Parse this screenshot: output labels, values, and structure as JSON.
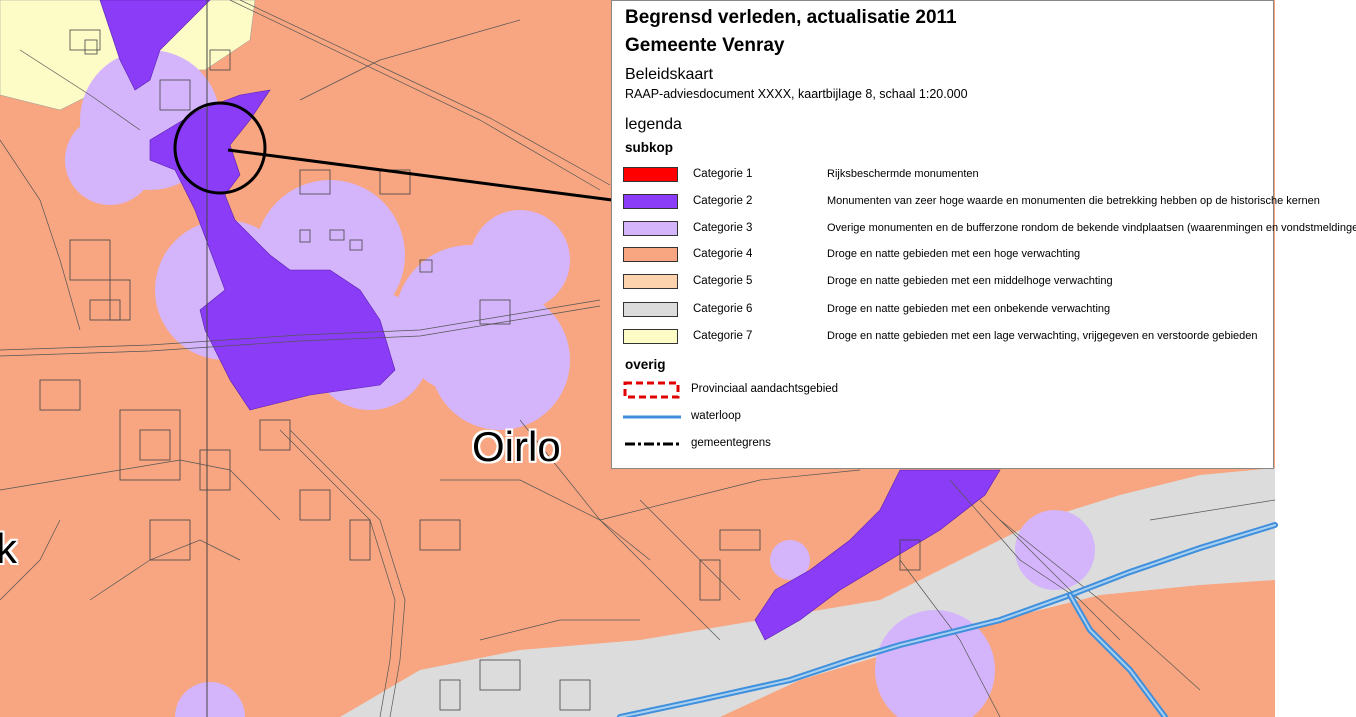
{
  "title_line1": "Begrensd verleden, actualisatie 2011",
  "title_line2": "Gemeente Venray",
  "map_type": "Beleidskaart",
  "document_note": "RAAP-adviesdocument XXXX, kaartbijlage 8, schaal 1:20.000",
  "legend_heading": "legenda",
  "subkop_label": "subkop",
  "categories": [
    {
      "label": "Categorie 1",
      "description": "Rijksbeschermde monumenten",
      "color": "#ff0000"
    },
    {
      "label": "Categorie 2",
      "description": "Monumenten van zeer hoge waarde en monumenten die betrekking hebben op de historische kernen",
      "color": "#8b3cf7"
    },
    {
      "label": "Categorie 3",
      "description": "Overige monumenten en de bufferzone rondom de bekende vindplaatsen (waarenmingen en vondstmeldingen)",
      "color": "#d4b5fb"
    },
    {
      "label": "Categorie 4",
      "description": "Droge en natte gebieden met een hoge verwachting",
      "color": "#f7a681"
    },
    {
      "label": "Categorie 5",
      "description": "Droge en natte gebieden met een middelhoge verwachting",
      "color": "#fdd3ae"
    },
    {
      "label": "Categorie 6",
      "description": "Droge en natte gebieden met een onbekende verwachting",
      "color": "#dcdcdc"
    },
    {
      "label": "Categorie 7",
      "description": "Droge en natte gebieden met een lage verwachting, vrijgegeven en verstoorde gebieden",
      "color": "#fdfbc6"
    }
  ],
  "overig_label": "overig",
  "other_symbols": [
    {
      "label": "Provinciaal aandachtsgebied",
      "symbol": "dashed-red-box",
      "color": "#e00000"
    },
    {
      "label": "waterloop",
      "symbol": "blue-line",
      "color": "#3f8fdc"
    },
    {
      "label": "gemeentegrens",
      "symbol": "dash-dot-line",
      "color": "#000000"
    }
  ],
  "place_labels": {
    "oirlo": "Oirlo",
    "left_edge_fragment": "k"
  }
}
